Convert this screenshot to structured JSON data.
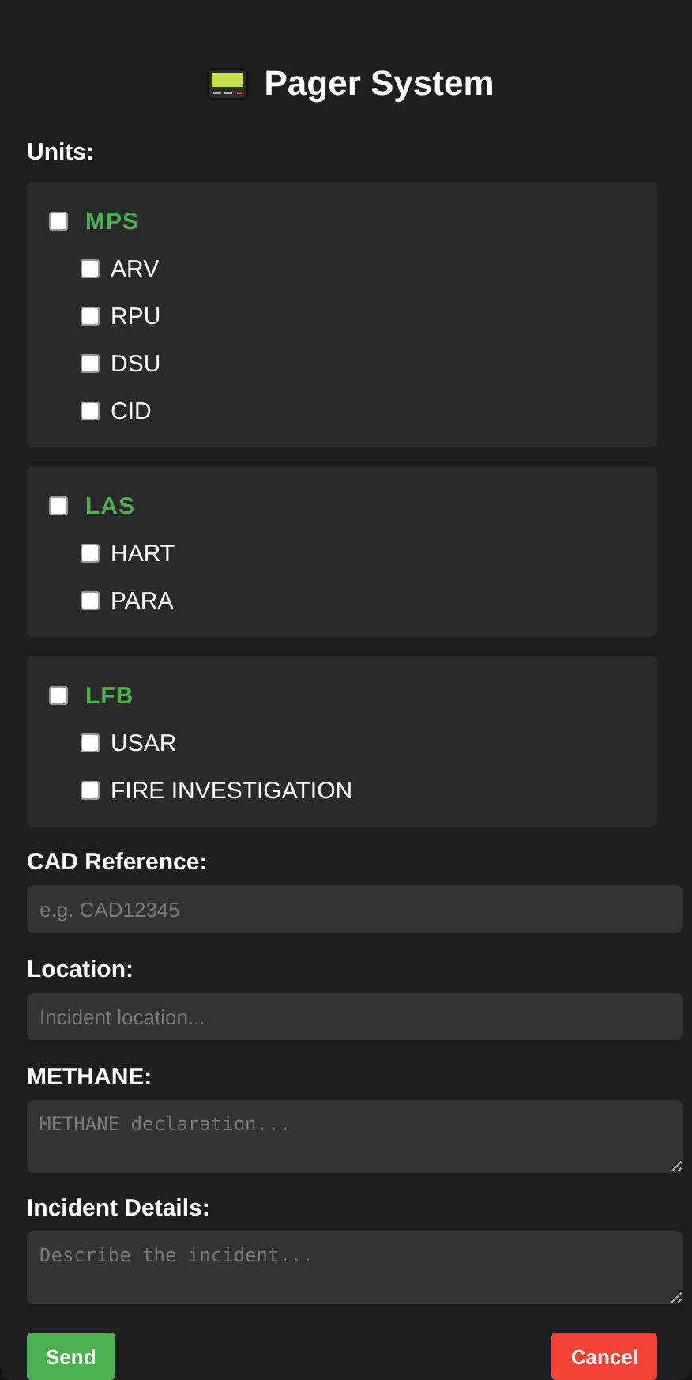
{
  "title": "Pager System",
  "units_label": "Units:",
  "groups": [
    {
      "name": "MPS",
      "checked": false,
      "units": [
        {
          "label": "ARV",
          "checked": false
        },
        {
          "label": "RPU",
          "checked": false
        },
        {
          "label": "DSU",
          "checked": false
        },
        {
          "label": "CID",
          "checked": false
        }
      ]
    },
    {
      "name": "LAS",
      "checked": false,
      "units": [
        {
          "label": "HART",
          "checked": false
        },
        {
          "label": "PARA",
          "checked": false
        }
      ]
    },
    {
      "name": "LFB",
      "checked": false,
      "units": [
        {
          "label": "USAR",
          "checked": false
        },
        {
          "label": "FIRE INVESTIGATION",
          "checked": false
        }
      ]
    }
  ],
  "fields": [
    {
      "label": "CAD Reference:",
      "kind": "input",
      "placeholder": "e.g. CAD12345"
    },
    {
      "label": "Location:",
      "kind": "input",
      "placeholder": "Incident location..."
    },
    {
      "label": "METHANE:",
      "kind": "textarea",
      "placeholder": "METHANE declaration..."
    },
    {
      "label": "Incident Details:",
      "kind": "textarea",
      "placeholder": "Describe the incident..."
    }
  ],
  "buttons": [
    {
      "label": "Send",
      "kind": "primary"
    },
    {
      "label": "Cancel",
      "kind": "danger"
    }
  ]
}
